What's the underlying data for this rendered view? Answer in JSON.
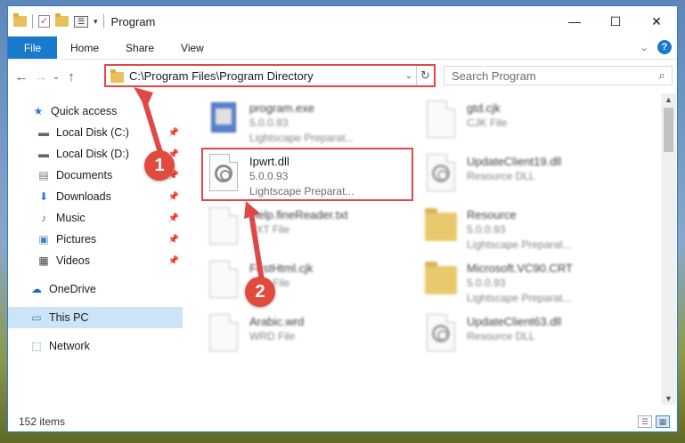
{
  "titlebar": {
    "title": "Program",
    "min_icon": "minimize-icon",
    "max_icon": "maximize-icon",
    "close_icon": "close-icon"
  },
  "ribbon": {
    "tabs": [
      {
        "label": "File",
        "active": true
      },
      {
        "label": "Home"
      },
      {
        "label": "Share"
      },
      {
        "label": "View"
      }
    ],
    "accent": "#1979ca"
  },
  "nav": {
    "address": "C:\\Program Files\\Program Directory",
    "search_placeholder": "Search Program"
  },
  "sidebar": {
    "quick_access": "Quick access",
    "items": [
      {
        "label": "Local Disk (C:)",
        "icon": "drive-icon",
        "pinned": true
      },
      {
        "label": "Local Disk (D:)",
        "icon": "drive-icon",
        "pinned": true
      },
      {
        "label": "Documents",
        "icon": "documents-icon",
        "pinned": true
      },
      {
        "label": "Downloads",
        "icon": "downloads-icon",
        "pinned": true
      },
      {
        "label": "Music",
        "icon": "music-icon",
        "pinned": true
      },
      {
        "label": "Pictures",
        "icon": "pictures-icon",
        "pinned": true
      },
      {
        "label": "Videos",
        "icon": "videos-icon",
        "pinned": true
      }
    ],
    "onedrive": "OneDrive",
    "this_pc": "This PC",
    "network": "Network"
  },
  "files": [
    {
      "name": "program.exe",
      "l2": "5.0.0.93",
      "l3": "Lightscape Preparat...",
      "icon": "exe-icon"
    },
    {
      "name": "gtd.cjk",
      "l2": "CJK File",
      "l3": "",
      "icon": "document-icon"
    },
    {
      "name": "Ipwrt.dll",
      "l2": "5.0.0.93",
      "l3": "Lightscape Preparat...",
      "icon": "dll-gear-icon"
    },
    {
      "name": "UpdateClient19.dll",
      "l2": "Resource DLL",
      "l3": "",
      "icon": "dll-gear-icon"
    },
    {
      "name": "Help.fineReader.txt",
      "l2": "TXT File",
      "l3": "",
      "icon": "document-icon"
    },
    {
      "name": "Resource",
      "l2": "5.0.0.93",
      "l3": "Lightscape Preparat...",
      "icon": "folder-icon"
    },
    {
      "name": "FirstHtml.cjk",
      "l2": "CJK File",
      "l3": "",
      "icon": "document-icon"
    },
    {
      "name": "Microsoft.VC90.CRT",
      "l2": "5.0.0.93",
      "l3": "Lightscape Preparat...",
      "icon": "folder-icon"
    },
    {
      "name": "Arabic.wrd",
      "l2": "WRD File",
      "l3": "",
      "icon": "document-icon"
    },
    {
      "name": "UpdateClient63.dll",
      "l2": "Resource DLL",
      "l3": "",
      "icon": "dll-gear-icon"
    }
  ],
  "status": {
    "count": "152 items"
  },
  "annotations": {
    "step1": "1",
    "step2": "2",
    "color": "#e04848"
  }
}
